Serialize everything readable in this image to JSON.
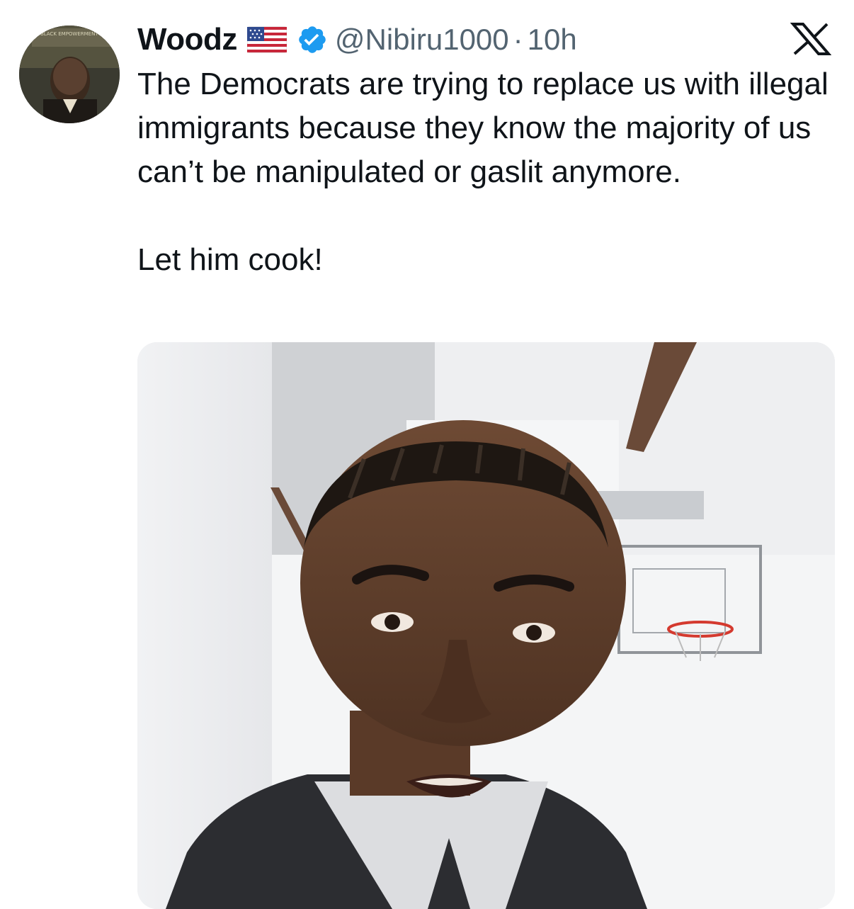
{
  "author": {
    "display_name": "Woodz",
    "flag_icon": "us-flag-icon",
    "verified_icon": "verified-badge-icon",
    "verified_color": "#1d9bf0",
    "handle": "@Nibiru1000",
    "separator": "·",
    "timestamp": "10h"
  },
  "platform": {
    "logo_icon": "x-logo-icon"
  },
  "tweet": {
    "paragraphs": [
      "The Democrats are trying to replace us with illegal immigrants because they know the majority of us can’t be manipulated or gaslit anymore.",
      "Let him cook!"
    ]
  },
  "media": {
    "type": "video-thumbnail",
    "avatar_sign_text": "BLACK EMPOWERMENT"
  },
  "colors": {
    "text_primary": "#0f1419",
    "text_secondary": "#536471",
    "background": "#ffffff"
  }
}
